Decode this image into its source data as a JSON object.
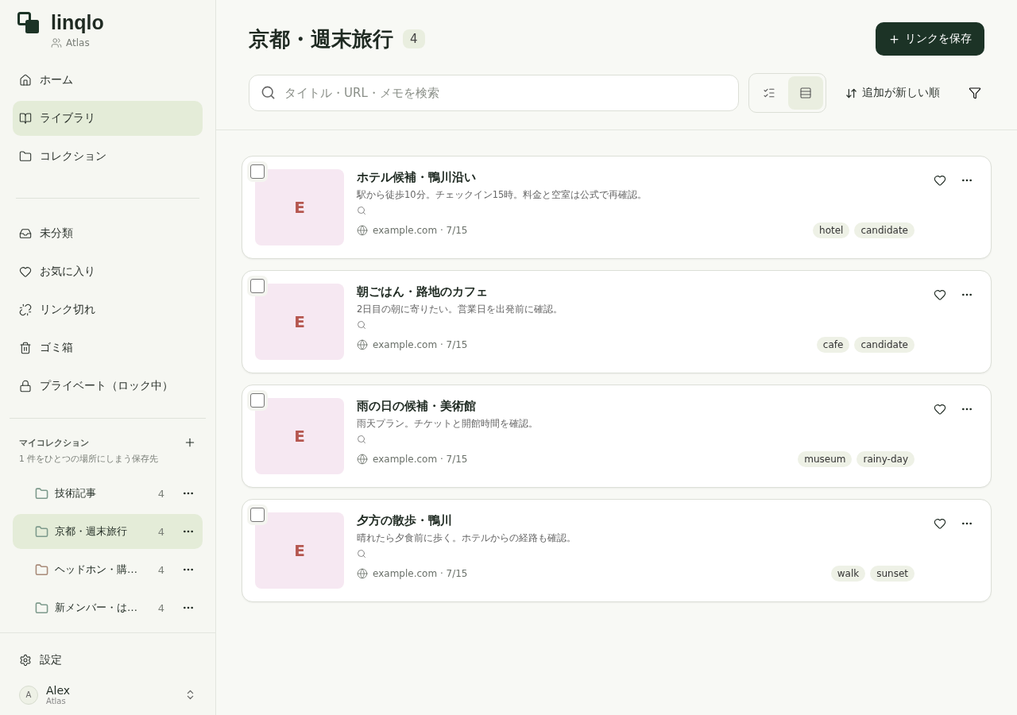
{
  "brand": {
    "name": "linqlo",
    "workspace": "Atlas"
  },
  "nav": [
    {
      "label": "ホーム",
      "selected": false
    },
    {
      "label": "ライブラリ",
      "selected": true
    },
    {
      "label": "コレクション",
      "selected": false
    }
  ],
  "nav2": [
    {
      "label": "未分類"
    },
    {
      "label": "お気に入り"
    },
    {
      "label": "リンク切れ"
    },
    {
      "label": "ゴミ箱"
    },
    {
      "label": "プライベート（ロック中）"
    }
  ],
  "my_collections": {
    "title": "マイコレクション",
    "subtitle": "1 件をひとつの場所にしまう保存先",
    "items": [
      {
        "name": "技術記事",
        "count": "4",
        "selected": false,
        "color": "#7d9a8c"
      },
      {
        "name": "京都・週末旅行",
        "count": "4",
        "selected": true,
        "color": "#7d9a8c"
      },
      {
        "name": "ヘッドホン・購…",
        "count": "4",
        "selected": false,
        "color": "#a88a78"
      },
      {
        "name": "新メンバー・は…",
        "count": "4",
        "selected": false,
        "color": "#7d9a8c"
      }
    ]
  },
  "settings": "設定",
  "user": {
    "initial": "A",
    "name": "Alex",
    "workspace": "Atlas"
  },
  "header": {
    "title": "京都・週末旅行",
    "count": "4",
    "save_button": "リンクを保存"
  },
  "search": {
    "placeholder": "タイトル・URL・メモを検索"
  },
  "view_toggle": [
    {
      "kind": "compact",
      "selected": false
    },
    {
      "kind": "cards",
      "selected": true
    }
  ],
  "sort": "追加が新しい順",
  "links": [
    {
      "title": "ホテル候補・鴨川沿い",
      "note": "駅から徒歩10分。チェックイン15時。料金と空室は公式で再確認。",
      "thumb": "E",
      "source": "example.com · 7/15",
      "tags": [
        "hotel",
        "candidate"
      ],
      "checked": false,
      "favorite": false
    },
    {
      "title": "朝ごはん・路地のカフェ",
      "note": "2日目の朝に寄りたい。営業日を出発前に確認。",
      "thumb": "E",
      "source": "example.com · 7/15",
      "tags": [
        "cafe",
        "candidate"
      ],
      "checked": false,
      "favorite": false
    },
    {
      "title": "雨の日の候補・美術館",
      "note": "雨天プラン。チケットと開館時間を確認。",
      "thumb": "E",
      "source": "example.com · 7/15",
      "tags": [
        "museum",
        "rainy-day"
      ],
      "checked": false,
      "favorite": false
    },
    {
      "title": "夕方の散歩・鴨川",
      "note": "晴れたら夕食前に歩く。ホテルからの経路も確認。",
      "thumb": "E",
      "source": "example.com · 7/15",
      "tags": [
        "walk",
        "sunset"
      ],
      "checked": false,
      "favorite": false
    }
  ]
}
